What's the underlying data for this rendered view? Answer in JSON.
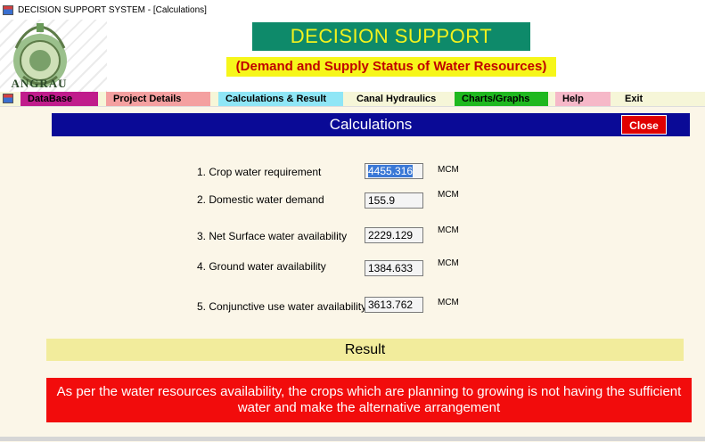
{
  "window": {
    "title": "DECISION SUPPORT SYSTEM  - [Calculations]"
  },
  "logo": {
    "text": "ANGRAU"
  },
  "header": {
    "title": "DECISION SUPPORT SYSTEM",
    "subtitle": "(Demand and Supply Status of Water Resources)"
  },
  "menu": {
    "items": [
      {
        "label": "DataBase",
        "color": "#c01c8c"
      },
      {
        "label": "Project Details",
        "color": "#f4a0a0"
      },
      {
        "label": "Calculations & Result",
        "color": "#8fe6f6"
      },
      {
        "label": "Canal Hydraulics",
        "color": "#f6f6d8"
      },
      {
        "label": "Charts/Graphs",
        "color": "#1fb81f"
      },
      {
        "label": "Help",
        "color": "#f6b8c8"
      },
      {
        "label": "Exit",
        "color": "#f6f6d8"
      }
    ]
  },
  "calculations": {
    "title": "Calculations",
    "close_label": "Close",
    "rows": [
      {
        "label": "1. Crop water requirement",
        "value": "4455.316",
        "unit": "MCM"
      },
      {
        "label": "2. Domestic water demand",
        "value": "155.9",
        "unit": "MCM"
      },
      {
        "label": "3. Net Surface water availability",
        "value": "2229.129",
        "unit": "MCM"
      },
      {
        "label": "4. Ground water availability",
        "value": "1384.633",
        "unit": "MCM"
      },
      {
        "label": "5. Conjunctive use water availability",
        "value": "3613.762",
        "unit": "MCM"
      }
    ]
  },
  "result": {
    "title": "Result",
    "message": "As per the water resources availability, the crops which are planning to growing is not having the sufficient water and make the alternative arrangement"
  },
  "colors": {
    "title_bg": "#0e8a6a",
    "title_fg": "#f2f21e",
    "subtitle_bg": "#f6f61a",
    "subtitle_fg": "#c00000",
    "panel_header_bg": "#0a0a96",
    "close_bg": "#e00000",
    "result_header_bg": "#f2ec9c",
    "result_box_bg": "#f20c0c"
  }
}
